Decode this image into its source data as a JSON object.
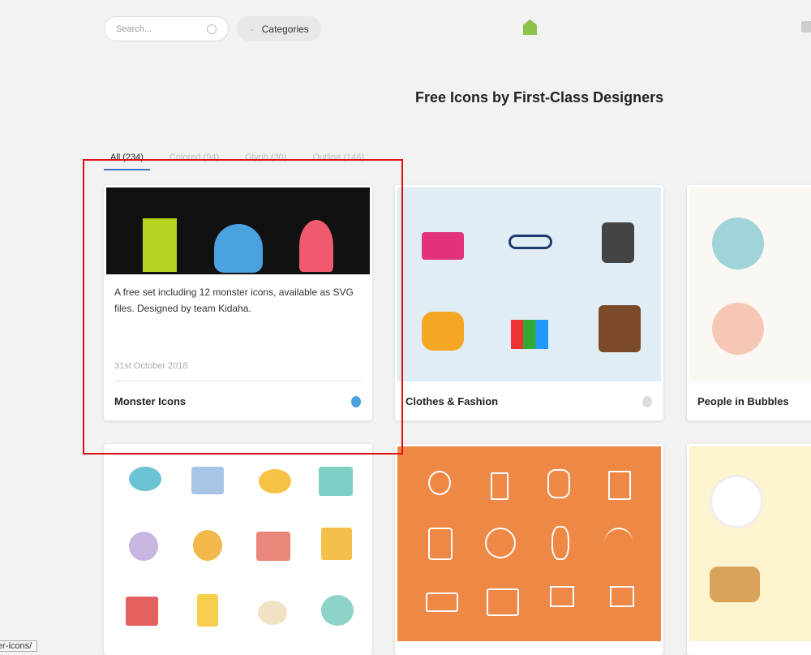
{
  "header": {
    "search_placeholder": "Search...",
    "categories_label": "Categories",
    "title": "Free Icons by First-Class Designers"
  },
  "tabs": [
    {
      "label": "All (234)",
      "active": true
    },
    {
      "label": "Colored (94)"
    },
    {
      "label": "Glyph (30)"
    },
    {
      "label": "Outline (146)"
    }
  ],
  "cards": [
    {
      "title": "Monster Icons",
      "description": "A free set including 12 monster icons, available as SVG files. Designed by team Kidaha.",
      "date": "31st October 2018",
      "bg": "#111111"
    },
    {
      "title": "Clothes & Fashion",
      "bg": "#e0edf5"
    },
    {
      "title": "People in Bubbles",
      "bg": "#fbf7f3"
    },
    {
      "bg": "#ffffff"
    },
    {
      "bg": "#ef8845"
    },
    {
      "bg": "#fdf3cf"
    }
  ],
  "status_tooltip": "er-icons/"
}
